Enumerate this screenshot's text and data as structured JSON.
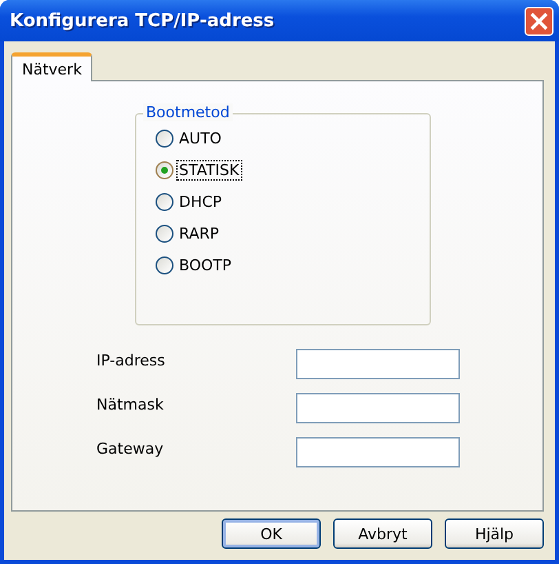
{
  "window": {
    "title": "Konfigurera TCP/IP-adress"
  },
  "tabs": [
    {
      "label": "Nätverk",
      "selected": true
    }
  ],
  "boot_method": {
    "legend": "Bootmetod",
    "options": [
      {
        "label": "AUTO",
        "selected": false
      },
      {
        "label": "STATISK",
        "selected": true
      },
      {
        "label": "DHCP",
        "selected": false
      },
      {
        "label": "RARP",
        "selected": false
      },
      {
        "label": "BOOTP",
        "selected": false
      }
    ]
  },
  "fields": [
    {
      "label": "IP-adress"
    },
    {
      "label": "Nätmask"
    },
    {
      "label": "Gateway"
    }
  ],
  "buttons": [
    {
      "label": "OK",
      "default": true
    },
    {
      "label": "Avbryt",
      "default": false
    },
    {
      "label": "Hjälp",
      "default": false
    }
  ]
}
